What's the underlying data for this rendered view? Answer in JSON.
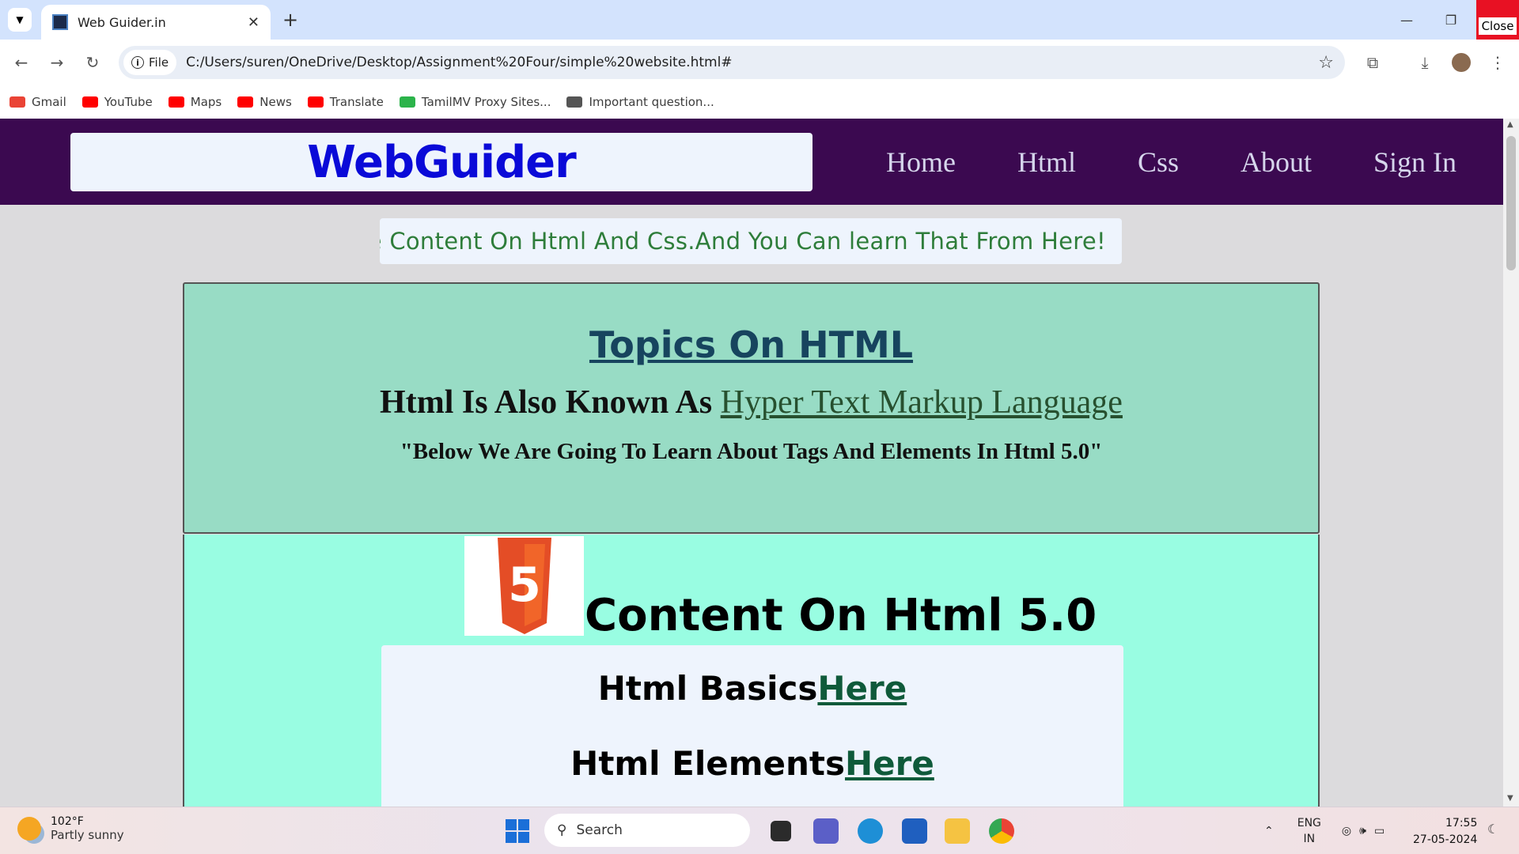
{
  "browser": {
    "tab_title": "Web Guider.in",
    "tab_close": "✕",
    "new_tab": "+",
    "window_close_label": "Close",
    "file_chip": "File",
    "url": "C:/Users/suren/OneDrive/Desktop/Assignment%20Four/simple%20website.html#",
    "bookmarks": [
      {
        "label": "Gmail",
        "color": "#ea4335"
      },
      {
        "label": "YouTube",
        "color": "#ff0000"
      },
      {
        "label": "Maps",
        "color": "#ff0000"
      },
      {
        "label": "News",
        "color": "#ff0000"
      },
      {
        "label": "Translate",
        "color": "#ff0000"
      },
      {
        "label": "TamilMV Proxy Sites...",
        "color": "#2bb34a"
      },
      {
        "label": "Important question...",
        "color": "#555555"
      }
    ]
  },
  "site": {
    "logo": "WebGuider",
    "nav": [
      "Home",
      "Html",
      "Css",
      "About",
      "Sign In"
    ],
    "marquee": "he Content On Html And Css.And You Can learn That From Here!",
    "topics": {
      "heading": "Topics On HTML",
      "sub_prefix": "Html Is Also Known As ",
      "sub_link": "Hyper Text Markup Language",
      "note": "\"Below We Are Going To Learn About Tags And Elements In Html 5.0\""
    },
    "content": {
      "heading": "Content On Html 5.0",
      "lines": [
        {
          "text": "Html Basics",
          "link": "Here"
        },
        {
          "text": "Html Elements",
          "link": "Here"
        }
      ]
    }
  },
  "taskbar": {
    "temperature": "102°F",
    "weather": "Partly sunny",
    "search": "Search",
    "lang_top": "ENG",
    "lang_bottom": "IN",
    "time": "17:55",
    "date": "27-05-2024"
  },
  "colors": {
    "header_bg": "#3b0950",
    "logo": "#0a0ad8",
    "topics_bg": "#98dcc5",
    "content_bg": "#99fde2",
    "marquee_text": "#2e7d3a"
  }
}
